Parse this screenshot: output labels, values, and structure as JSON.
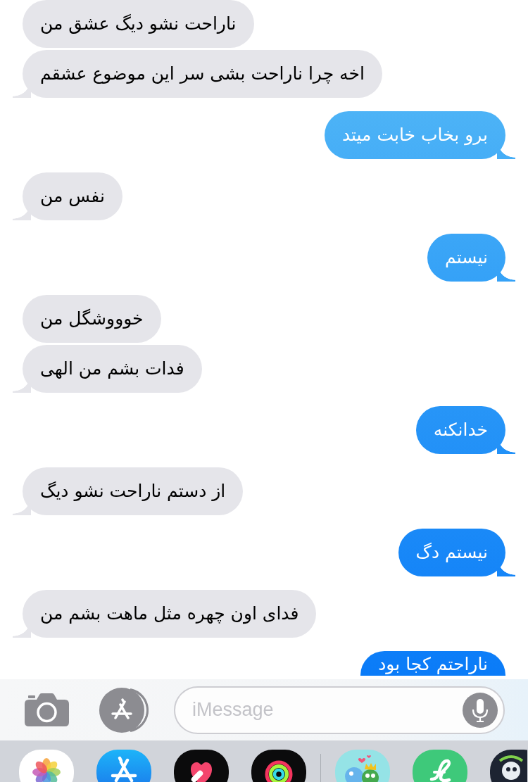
{
  "messages": [
    {
      "kind": "received",
      "text": "ناراحت نشو دیگ عشق من"
    },
    {
      "kind": "received",
      "text": "اخه چرا ناراحت بشی سر این موضوع عشقم"
    },
    {
      "kind": "sent",
      "text": "برو بخاب خابت میتد"
    },
    {
      "kind": "received",
      "text": "نفس من"
    },
    {
      "kind": "sent",
      "text": "نیستم"
    },
    {
      "kind": "received",
      "text": "خوووشگل من"
    },
    {
      "kind": "received",
      "text": "فدات بشم من الهی"
    },
    {
      "kind": "sent",
      "text": "خدانکنه"
    },
    {
      "kind": "received",
      "text": "از دستم ناراحت نشو دیگ"
    },
    {
      "kind": "sent",
      "text": "نیستم دگ"
    },
    {
      "kind": "received",
      "text": "فدای اون چهره مثل ماهت بشم من"
    },
    {
      "kind": "sent",
      "text": "ناراحتم کجا بود"
    }
  ],
  "composer": {
    "placeholder": "iMessage"
  }
}
